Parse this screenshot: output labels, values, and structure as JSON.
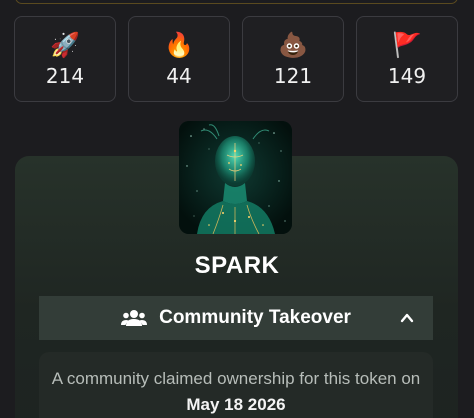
{
  "reactions": [
    {
      "icon": "rocket-icon",
      "emoji": "🚀",
      "count": "214"
    },
    {
      "icon": "fire-icon",
      "emoji": "🔥",
      "count": "44"
    },
    {
      "icon": "poop-icon",
      "emoji": "💩",
      "count": "121"
    },
    {
      "icon": "red-flag-icon",
      "emoji": "🚩",
      "count": "149"
    }
  ],
  "token": {
    "name": "SPARK"
  },
  "community_takeover": {
    "title": "Community Takeover",
    "description_prefix": "A community claimed ownership for this token on",
    "date": "May 18 2026",
    "expanded": true
  },
  "colors": {
    "background": "#1c1c1f",
    "panel": "#27322a",
    "bar": "#333d38"
  }
}
